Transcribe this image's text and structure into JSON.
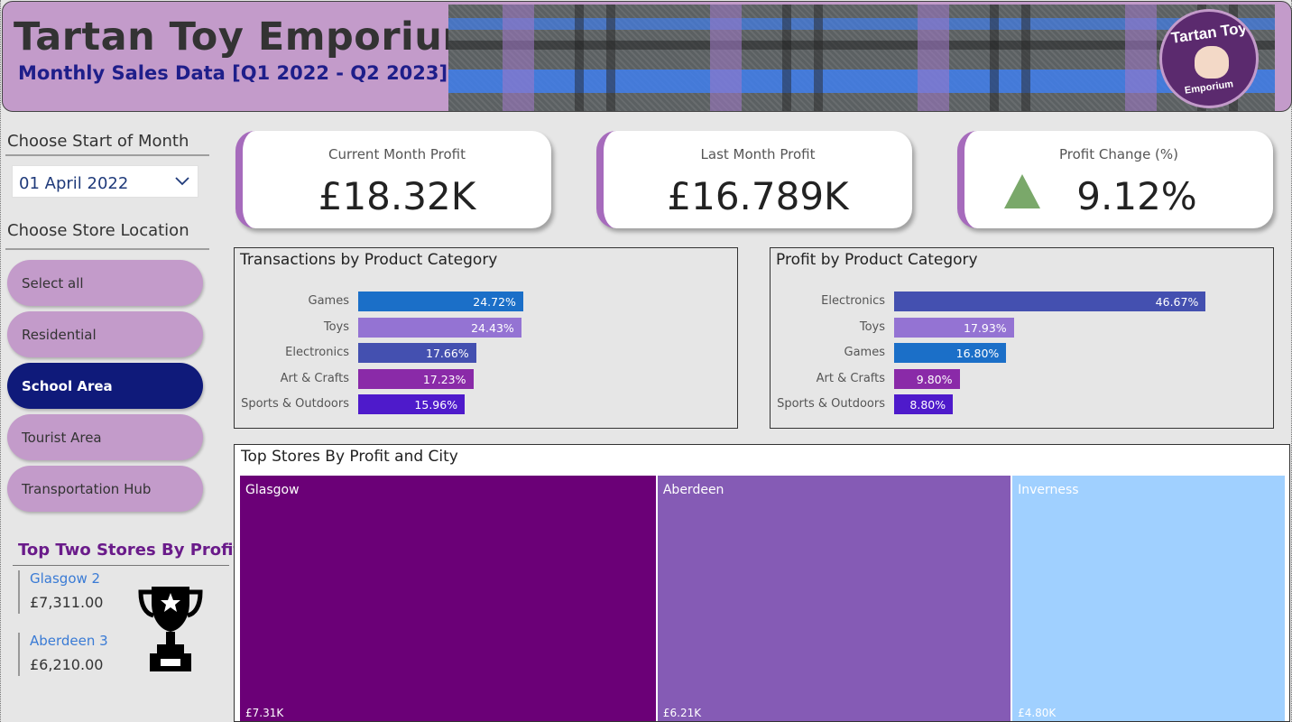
{
  "header": {
    "title": "Tartan Toy Emporium",
    "subtitle": "Monthly Sales Data [Q1 2022 - Q2 2023]",
    "logo_top": "Tartan Toy",
    "logo_bottom": "Emporium"
  },
  "filters": {
    "month_label": "Choose Start of Month",
    "month_value": "01 April 2022",
    "location_label": "Choose Store Location",
    "locations": [
      {
        "label": "Select all",
        "selected": false
      },
      {
        "label": "Residential",
        "selected": false
      },
      {
        "label": "School Area",
        "selected": true
      },
      {
        "label": "Tourist Area",
        "selected": false
      },
      {
        "label": "Transportation Hub",
        "selected": false
      }
    ]
  },
  "top_stores": {
    "title": "Top Two Stores By Profit",
    "items": [
      {
        "name": "Glasgow 2",
        "value": "£7,311.00"
      },
      {
        "name": "Aberdeen 3",
        "value": "£6,210.00"
      }
    ],
    "icon": "trophy-icon"
  },
  "kpis": [
    {
      "label": "Current Month Profit",
      "value": "£18.32K"
    },
    {
      "label": "Last Month Profit",
      "value": "£16.789K"
    },
    {
      "label": "Profit Change (%)",
      "value": "9.12%",
      "icon": "up-triangle-icon"
    }
  ],
  "colors": {
    "accent": "#a66bbc",
    "header_bg": "#c39bca",
    "selected_slicer": "#0f1a7a",
    "up_arrow": "#7aa86a"
  },
  "chart_data": [
    {
      "type": "bar",
      "title": "Transactions by Product Category",
      "categories": [
        "Games",
        "Toys",
        "Electronics",
        "Art & Crafts",
        "Sports & Outdoors"
      ],
      "values": [
        24.72,
        24.43,
        17.66,
        17.23,
        15.96
      ],
      "labels": [
        "24.72%",
        "24.43%",
        "17.66%",
        "17.23%",
        "15.96%"
      ],
      "colors": [
        "#1b6fc8",
        "#9473d3",
        "#4450b0",
        "#8a2aa8",
        "#4e1acb"
      ]
    },
    {
      "type": "bar",
      "title": "Profit by Product Category",
      "categories": [
        "Electronics",
        "Toys",
        "Games",
        "Art & Crafts",
        "Sports & Outdoors"
      ],
      "values": [
        46.67,
        17.93,
        16.8,
        9.8,
        8.8
      ],
      "labels": [
        "46.67%",
        "17.93%",
        "16.80%",
        "9.80%",
        "8.80%"
      ],
      "colors": [
        "#4450b0",
        "#9473d3",
        "#1b6fc8",
        "#8a2aa8",
        "#4e1acb"
      ]
    },
    {
      "type": "treemap",
      "title": "Top Stores By Profit and City",
      "categories": [
        "Glasgow",
        "Aberdeen",
        "Inverness"
      ],
      "values": [
        7.31,
        6.21,
        4.8
      ],
      "labels": [
        "£7.31K",
        "£6.21K",
        "£4.80K"
      ],
      "colors": [
        "#6b0077",
        "#855bb5",
        "#a0d0ff"
      ]
    }
  ]
}
